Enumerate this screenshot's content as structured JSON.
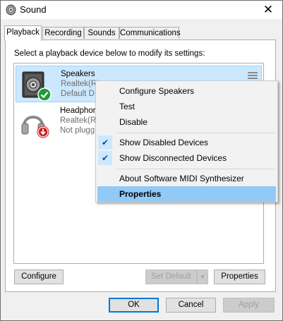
{
  "window": {
    "title": "Sound"
  },
  "tabs": [
    {
      "label": "Playback",
      "active": true
    },
    {
      "label": "Recording"
    },
    {
      "label": "Sounds"
    },
    {
      "label": "Communications"
    }
  ],
  "instruction": "Select a playback device below to modify its settings:",
  "devices": [
    {
      "name": "Speakers",
      "line2": "Realtek(R)",
      "line3": "Default D",
      "status_icon": "green-check-icon",
      "selected": true
    },
    {
      "name": "Headphor",
      "line2": "Realtek(R)",
      "line3": "Not plugg",
      "status_icon": "red-down-arrow-icon",
      "selected": false
    }
  ],
  "context_menu": {
    "items": [
      {
        "label": "Configure Speakers"
      },
      {
        "label": "Test"
      },
      {
        "label": "Disable"
      },
      {
        "label": "Show Disabled Devices",
        "checked": true
      },
      {
        "label": "Show Disconnected Devices",
        "checked": true
      },
      {
        "label": "About Software MIDI Synthesizer"
      },
      {
        "label": "Properties",
        "highlighted": true
      }
    ]
  },
  "buttons": {
    "configure": "Configure",
    "set_default": "Set Default",
    "properties": "Properties",
    "ok": "OK",
    "cancel": "Cancel",
    "apply": "Apply"
  },
  "colors": {
    "selection": "#cce8ff",
    "menu_highlight": "#91c9f7",
    "default_button_border": "#0078d7",
    "status_ok": "#1e9c3a",
    "status_unplugged": "#d21f1f"
  }
}
